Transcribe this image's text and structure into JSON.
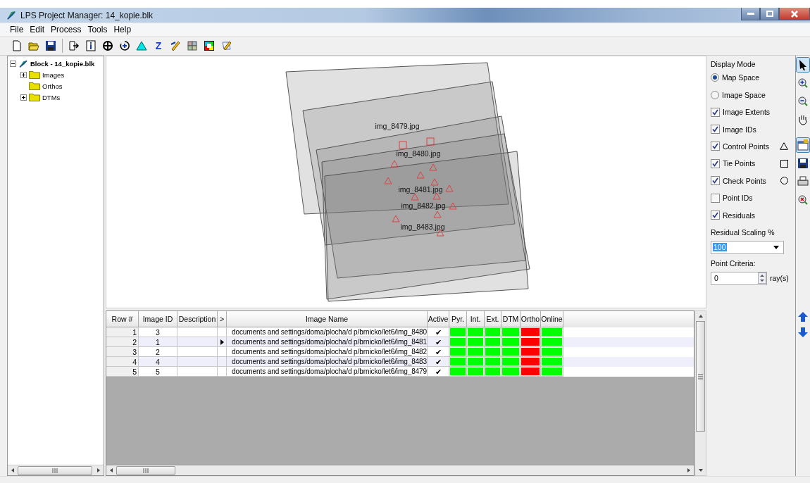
{
  "window": {
    "title": "LPS Project Manager: 14_kopie.blk"
  },
  "menu": [
    "File",
    "Edit",
    "Process",
    "Tools",
    "Help"
  ],
  "toolbar": [
    {
      "kind": "new"
    },
    {
      "kind": "open"
    },
    {
      "kind": "save"
    },
    {
      "kind": "sep"
    },
    {
      "kind": "export"
    },
    {
      "kind": "info"
    },
    {
      "kind": "target"
    },
    {
      "kind": "rotate"
    },
    {
      "kind": "triangle"
    },
    {
      "kind": "letter",
      "label": "Z"
    },
    {
      "kind": "pencil"
    },
    {
      "kind": "grid"
    },
    {
      "kind": "colors"
    },
    {
      "kind": "edit"
    }
  ],
  "tree": {
    "label": "Block - 14_kopie.blk",
    "expanded": true,
    "children": [
      {
        "label": "Images",
        "expanded": false
      },
      {
        "label": "Orthos"
      },
      {
        "label": "DTMs",
        "expanded": false
      }
    ]
  },
  "map": {
    "labels": [
      "img_8479.jpg",
      "img_8480.jpg",
      "img_8481.jpg",
      "img_8482.jpg",
      "img_8483.jpg"
    ]
  },
  "display_panel": {
    "heading": "Display Mode",
    "modes": [
      {
        "label": "Map Space",
        "selected": true
      },
      {
        "label": "Image Space",
        "selected": false
      }
    ],
    "layers": [
      {
        "label": "Image Extents",
        "checked": true,
        "kind": "plain"
      },
      {
        "label": "Image IDs",
        "checked": true,
        "kind": "plain"
      },
      {
        "label": "Control Points",
        "checked": true,
        "kind": "triangle"
      },
      {
        "label": "Tie Points",
        "checked": true,
        "kind": "square"
      },
      {
        "label": "Check Points",
        "checked": true,
        "kind": "circle"
      },
      {
        "label": "Point IDs",
        "checked": false,
        "kind": "plain"
      },
      {
        "label": "Residuals",
        "checked": true,
        "kind": "plain"
      }
    ],
    "scaling_label": "Residual Scaling %",
    "scaling_value": "100",
    "criteria_label": "Point Criteria:",
    "criteria_value": "0",
    "criteria_unit": "ray(s)"
  },
  "side_tools": [
    {
      "kind": "pointer",
      "selected": true
    },
    {
      "kind": "zoom-in",
      "selected": false
    },
    {
      "kind": "zoom-out",
      "selected": false
    },
    {
      "kind": "pan",
      "selected": false
    },
    {
      "kind": "gap"
    },
    {
      "kind": "properties",
      "selected": true
    },
    {
      "kind": "save",
      "selected": false
    },
    {
      "kind": "print",
      "selected": false
    },
    {
      "kind": "clear",
      "selected": false
    }
  ],
  "table": {
    "columns": [
      "Row #",
      "Image ID",
      "Description",
      ">",
      "Image Name",
      "Active",
      "Pyr.",
      "Int.",
      "Ext.",
      "DTM",
      "Ortho",
      "Online"
    ],
    "rows": [
      {
        "row": "1",
        "image_id": "3",
        "current": false,
        "image_name": "documents and settings/doma/plocha/d p/brnicko/let6/img_8480",
        "active": "✔",
        "status": [
          {
            "color": "#00ff00"
          },
          {
            "color": "#00ff00"
          },
          {
            "color": "#00ff00"
          },
          {
            "color": "#00ff00"
          },
          {
            "color": "#ff0000"
          },
          {
            "color": "#00ff00"
          }
        ]
      },
      {
        "row": "2",
        "image_id": "1",
        "current": true,
        "image_name": "documents and settings/doma/plocha/d p/brnicko/let6/img_8481",
        "active": "✔",
        "status": [
          {
            "color": "#00ff00"
          },
          {
            "color": "#00ff00"
          },
          {
            "color": "#00ff00"
          },
          {
            "color": "#00ff00"
          },
          {
            "color": "#ff0000"
          },
          {
            "color": "#00ff00"
          }
        ]
      },
      {
        "row": "3",
        "image_id": "2",
        "current": false,
        "image_name": "documents and settings/doma/plocha/d p/brnicko/let6/img_8482",
        "active": "✔",
        "status": [
          {
            "color": "#00ff00"
          },
          {
            "color": "#00ff00"
          },
          {
            "color": "#00ff00"
          },
          {
            "color": "#00ff00"
          },
          {
            "color": "#ff0000"
          },
          {
            "color": "#00ff00"
          }
        ]
      },
      {
        "row": "4",
        "image_id": "4",
        "current": false,
        "image_name": "documents and settings/doma/plocha/d p/brnicko/let6/img_8483",
        "active": "✔",
        "status": [
          {
            "color": "#00ff00"
          },
          {
            "color": "#00ff00"
          },
          {
            "color": "#00ff00"
          },
          {
            "color": "#00ff00"
          },
          {
            "color": "#ff0000"
          },
          {
            "color": "#00ff00"
          }
        ]
      },
      {
        "row": "5",
        "image_id": "5",
        "current": false,
        "image_name": "documents and settings/doma/plocha/d p/brnicko/let6/img_8479",
        "active": "✔",
        "status": [
          {
            "color": "#00ff00"
          },
          {
            "color": "#00ff00"
          },
          {
            "color": "#00ff00"
          },
          {
            "color": "#00ff00"
          },
          {
            "color": "#ff0000"
          },
          {
            "color": "#00ff00"
          }
        ]
      }
    ]
  }
}
